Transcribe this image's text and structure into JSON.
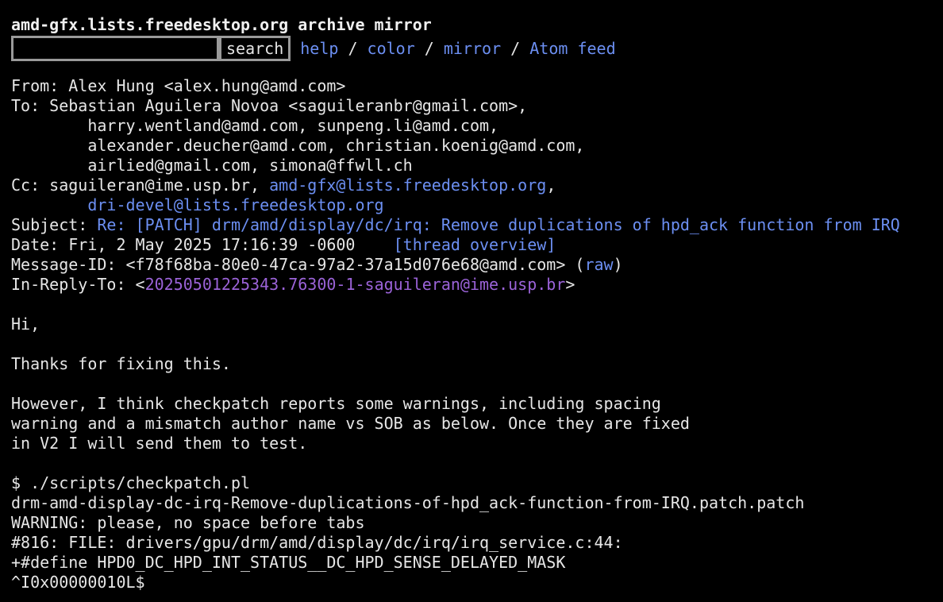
{
  "site": {
    "title": "amd-gfx.lists.freedesktop.org archive mirror"
  },
  "search": {
    "value": "",
    "button_label": "search"
  },
  "nav": {
    "help": "help",
    "color": "color",
    "mirror": "mirror",
    "atom": "Atom feed",
    "separator": " / "
  },
  "headers": {
    "from": "From: Alex Hung <alex.hung@amd.com>",
    "to_1": "To: Sebastian Aguilera Novoa <saguileranbr@gmail.com>,",
    "to_2": "        harry.wentland@amd.com, sunpeng.li@amd.com,",
    "to_3": "        alexander.deucher@amd.com, christian.koenig@amd.com,",
    "to_4": "        airlied@gmail.com, simona@ffwll.ch",
    "cc_prefix": "Cc: saguileran@ime.usp.br, ",
    "cc_link_1": "amd-gfx@lists.freedesktop.org",
    "cc_suffix": ",",
    "cc_indent": "        ",
    "cc_link_2": "dri-devel@lists.freedesktop.org",
    "subject_prefix": "Subject: ",
    "subject_link": "Re: [PATCH] drm/amd/display/dc/irq: Remove duplications of hpd_ack function from IRQ",
    "date": "Date: Fri, 2 May 2025 17:16:39 -0600    ",
    "thread_overview": "[thread overview]",
    "message_id": "Message-ID: <f78f68ba-80e0-47ca-97a2-37a15d076e68@amd.com> (",
    "raw": "raw",
    "message_id_close": ")",
    "in_reply_to_prefix": "In-Reply-To: <",
    "in_reply_to_link": "20250501225343.76300-1-saguileran@ime.usp.br",
    "in_reply_to_close": ">"
  },
  "body": {
    "greeting": "Hi,",
    "thanks": "Thanks for fixing this.",
    "para_1": "However, I think checkpatch reports some warnings, including spacing",
    "para_2": "warning and a mismatch author name vs SOB as below. Once they are fixed",
    "para_3": "in V2 I will send them to test.",
    "cmd": "$ ./scripts/checkpatch.pl",
    "patch_file": "drm-amd-display-dc-irq-Remove-duplications-of-hpd_ack-function-from-IRQ.patch.patch",
    "warning": "WARNING: please, no space before tabs",
    "file_ref": "#816: FILE: drivers/gpu/drm/amd/display/dc/irq/irq_service.c:44:",
    "define": "+#define HPD0_DC_HPD_INT_STATUS__DC_HPD_SENSE_DELAYED_MASK",
    "value": "^I0x00000010L$"
  },
  "colors": {
    "background": "#000000",
    "text": "#e6e6e6",
    "link": "#6c8ff2",
    "visited_link": "#9b63d8"
  }
}
